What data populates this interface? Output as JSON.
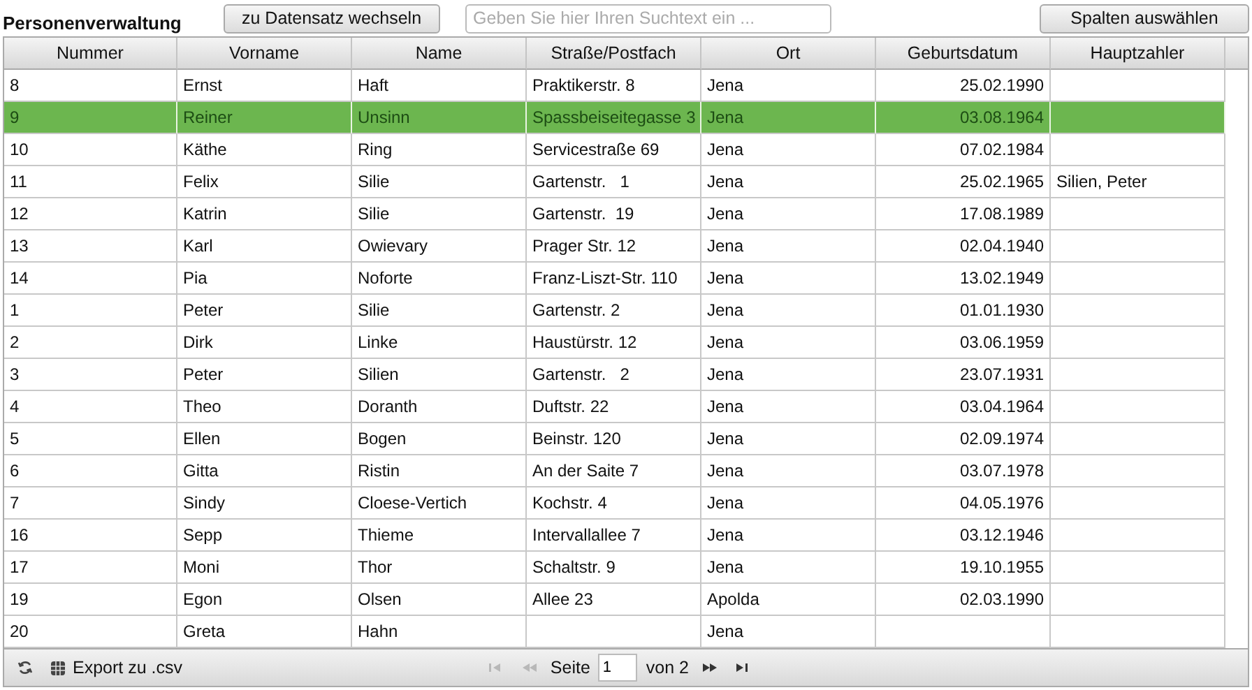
{
  "title": "Personenverwaltung",
  "goto_button": "zu Datensatz wechseln",
  "search": {
    "placeholder": "Geben Sie hier Ihren Suchtext ein ..."
  },
  "columns_button": "Spalten auswählen",
  "table": {
    "columns": [
      {
        "label": "Nummer",
        "kind": "text"
      },
      {
        "label": "Vorname",
        "kind": "text"
      },
      {
        "label": "Name",
        "kind": "text"
      },
      {
        "label": "Straße/Postfach",
        "kind": "text"
      },
      {
        "label": "Ort",
        "kind": "text"
      },
      {
        "label": "Geburtsdatum",
        "kind": "date"
      },
      {
        "label": "Hauptzahler",
        "kind": "text"
      }
    ],
    "rows": [
      {
        "selected": false,
        "cells": [
          "8",
          "Ernst",
          "Haft",
          "Praktikerstr. 8",
          "Jena",
          "25.02.1990",
          ""
        ]
      },
      {
        "selected": true,
        "cells": [
          "9",
          "Reiner",
          "Unsinn",
          "Spassbeiseitegasse 3",
          "Jena",
          "03.08.1964",
          ""
        ]
      },
      {
        "selected": false,
        "cells": [
          "10",
          "Käthe",
          "Ring",
          "Servicestraße 69",
          "Jena",
          "07.02.1984",
          ""
        ]
      },
      {
        "selected": false,
        "cells": [
          "11",
          "Felix",
          "Silie",
          "Gartenstr.   1",
          "Jena",
          "25.02.1965",
          "Silien, Peter"
        ]
      },
      {
        "selected": false,
        "cells": [
          "12",
          "Katrin",
          "Silie",
          "Gartenstr.  19",
          "Jena",
          "17.08.1989",
          ""
        ]
      },
      {
        "selected": false,
        "cells": [
          "13",
          "Karl",
          "Owievary",
          "Prager Str. 12",
          "Jena",
          "02.04.1940",
          ""
        ]
      },
      {
        "selected": false,
        "cells": [
          "14",
          "Pia",
          "Noforte",
          "Franz-Liszt-Str. 110",
          "Jena",
          "13.02.1949",
          ""
        ]
      },
      {
        "selected": false,
        "cells": [
          "1",
          "Peter",
          "Silie",
          "Gartenstr. 2",
          "Jena",
          "01.01.1930",
          ""
        ]
      },
      {
        "selected": false,
        "cells": [
          "2",
          "Dirk",
          "Linke",
          "Haustürstr. 12",
          "Jena",
          "03.06.1959",
          ""
        ]
      },
      {
        "selected": false,
        "cells": [
          "3",
          "Peter",
          "Silien",
          "Gartenstr.   2",
          "Jena",
          "23.07.1931",
          ""
        ]
      },
      {
        "selected": false,
        "cells": [
          "4",
          "Theo",
          "Doranth",
          "Duftstr. 22",
          "Jena",
          "03.04.1964",
          ""
        ]
      },
      {
        "selected": false,
        "cells": [
          "5",
          "Ellen",
          "Bogen",
          "Beinstr. 120",
          "Jena",
          "02.09.1974",
          ""
        ]
      },
      {
        "selected": false,
        "cells": [
          "6",
          "Gitta",
          "Ristin",
          "An der Saite 7",
          "Jena",
          "03.07.1978",
          ""
        ]
      },
      {
        "selected": false,
        "cells": [
          "7",
          "Sindy",
          "Cloese-Vertich",
          "Kochstr. 4",
          "Jena",
          "04.05.1976",
          ""
        ]
      },
      {
        "selected": false,
        "cells": [
          "16",
          "Sepp",
          "Thieme",
          "Intervallallee 7",
          "Jena",
          "03.12.1946",
          ""
        ]
      },
      {
        "selected": false,
        "cells": [
          "17",
          "Moni",
          "Thor",
          "Schaltstr. 9",
          "Jena",
          "19.10.1955",
          ""
        ]
      },
      {
        "selected": false,
        "cells": [
          "19",
          "Egon",
          "Olsen",
          "Allee 23",
          "Apolda",
          "02.03.1990",
          ""
        ]
      },
      {
        "selected": false,
        "cells": [
          "20",
          "Greta",
          "Hahn",
          "",
          "Jena",
          "",
          ""
        ]
      }
    ]
  },
  "footer": {
    "export": "Export zu .csv",
    "page_label": "Seite",
    "page": "1",
    "of_label": "von 2",
    "pager": [
      {
        "kind": "first",
        "disabled": true
      },
      {
        "kind": "prev",
        "disabled": true
      },
      {
        "kind": "next",
        "disabled": false
      },
      {
        "kind": "last",
        "disabled": false
      }
    ]
  }
}
